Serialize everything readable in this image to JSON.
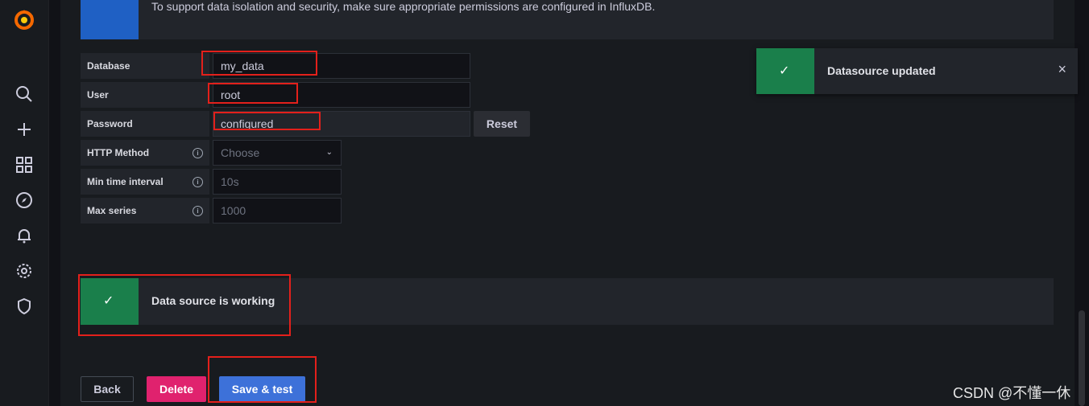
{
  "sidebar": {
    "icons": [
      "grafana-logo-icon",
      "search-icon",
      "plus-icon",
      "dashboards-icon",
      "explore-icon",
      "alerting-bell-icon",
      "gear-icon",
      "shield-icon"
    ]
  },
  "info": {
    "text": "To support data isolation and security, make sure appropriate permissions are configured in InfluxDB."
  },
  "form": {
    "database_label": "Database",
    "database_value": "my_data",
    "user_label": "User",
    "user_value": "root",
    "password_label": "Password",
    "password_value": "configured",
    "reset_label": "Reset",
    "http_method_label": "HTTP Method",
    "http_method_placeholder": "Choose",
    "min_interval_label": "Min time interval",
    "min_interval_placeholder": "10s",
    "max_series_label": "Max series",
    "max_series_placeholder": "1000",
    "info_glyph": "i"
  },
  "alert": {
    "text": "Data source is working",
    "icon": "check-icon"
  },
  "toast": {
    "text": "Datasource updated",
    "close": "×"
  },
  "actions": {
    "back": "Back",
    "delete": "Delete",
    "save": "Save & test"
  },
  "watermark": "CSDN @不懂一休",
  "colors": {
    "info_accent": "#1f60c4",
    "success": "#1a7f4b",
    "delete": "#e0226e",
    "primary": "#3d71d9",
    "highlight": "#e3201b"
  }
}
